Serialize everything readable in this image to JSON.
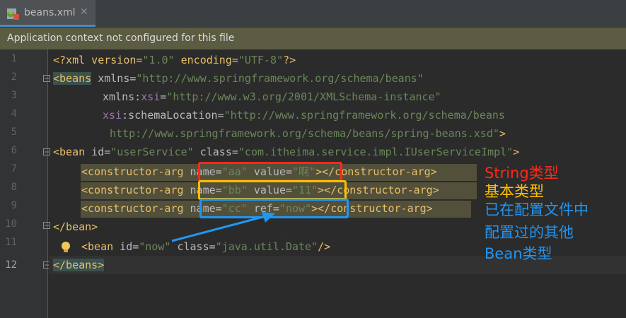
{
  "tab": {
    "title": "beans.xml",
    "close": "✕",
    "icon": "xml-file-icon"
  },
  "notice": {
    "text": "Application context not configured for this file"
  },
  "line_numbers": [
    "1",
    "2",
    "3",
    "4",
    "5",
    "6",
    "7",
    "8",
    "9",
    "10",
    "11",
    "12"
  ],
  "code": {
    "l1": {
      "p1": "<?xml version=",
      "p2": "\"1.0\"",
      "p3": " encoding=",
      "p4": "\"UTF-8\"",
      "p5": "?>"
    },
    "l2": {
      "tag": "<beans",
      "attr": " xmlns=",
      "val": "\"http://www.springframework.org/schema/beans\""
    },
    "l3": {
      "attr1": "xmlns:",
      "ns": "xsi",
      "attr2": "=",
      "val": "\"http://www.w3.org/2001/XMLSchema-instance\""
    },
    "l4": {
      "ns": "xsi",
      "attr": ":schemaLocation=",
      "val": "\"http://www.springframework.org/schema/beans"
    },
    "l5": {
      "val": "http://www.springframework.org/schema/beans/spring-beans.xsd\"",
      "tag": ">"
    },
    "l6": {
      "tag": "<bean",
      "a1": " id=",
      "v1": "\"userService\"",
      "a2": " class=",
      "v2": "\"com.itheima.service.impl.IUserServiceImpl\"",
      "tag2": ">"
    },
    "l7": {
      "tag": "<constructor-arg",
      "a1": " name=",
      "v1": "\"aa\"",
      "a2": " value=",
      "v2": "\"啊\"",
      "tag2": "></constructor-arg>"
    },
    "l8": {
      "tag": "<constructor-arg",
      "a1": " name=",
      "v1": "\"bb\"",
      "a2": " value=",
      "v2": "\"11\"",
      "tag2": "></constructor-arg>"
    },
    "l9": {
      "tag": "<constructor-arg",
      "a1": " name=",
      "v1": "\"cc\"",
      "a2": " ref=",
      "v2": "\"now\"",
      "tag2": "></constructor-arg>"
    },
    "l10": {
      "tag": "</bean>"
    },
    "l11": {
      "tag": "<bean",
      "a1": " id=",
      "v1": "\"now\"",
      "a2": " class=",
      "v2": "\"java.util.Date\"",
      "tag2": "/>"
    },
    "l12": {
      "tag": "</beans>"
    }
  },
  "annotations": {
    "string_type": "String类型",
    "basic_type": "基本类型",
    "ref_line1": "已在配置文件中",
    "ref_line2": "配置过的其他",
    "ref_line3": "Bean类型"
  },
  "colors": {
    "red": "#ff2a1a",
    "yellow": "#ffc000",
    "blue": "#2196f3",
    "tag": "#e8bf6a",
    "string": "#6a8759"
  }
}
